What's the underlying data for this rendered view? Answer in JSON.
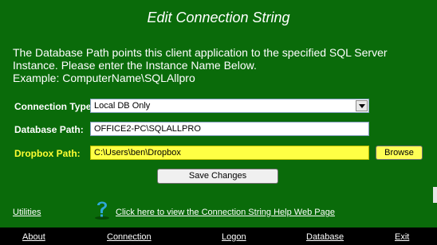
{
  "title": "Edit Connection String",
  "description": {
    "line1": "The Database Path points this client application to the specified SQL Server",
    "line2": "Instance.  Please enter the Instance Name Below.",
    "line3": "Example:  ComputerName\\SQLAllpro"
  },
  "form": {
    "connection_type_label": "Connection Type:",
    "connection_type_value": "Local DB Only",
    "database_path_label": "Database Path:",
    "database_path_value": "OFFICE2-PC\\SQLALLPRO",
    "dropbox_path_label": "Dropbox Path:",
    "dropbox_path_value": "C:\\Users\\ben\\Dropbox",
    "browse_label": "Browse",
    "save_label": "Save Changes"
  },
  "links": {
    "utilities": "Utilities",
    "help": "Click here to view the Connection String Help Web Page"
  },
  "nav": {
    "about": "About",
    "connection": "Connection",
    "logon": "Logon",
    "database": "Database",
    "exit": "Exit"
  },
  "colors": {
    "background": "#0a6b0a",
    "highlight": "#ffff44",
    "bottom_bar": "#000000",
    "help_icon": "#2ea8d8"
  }
}
